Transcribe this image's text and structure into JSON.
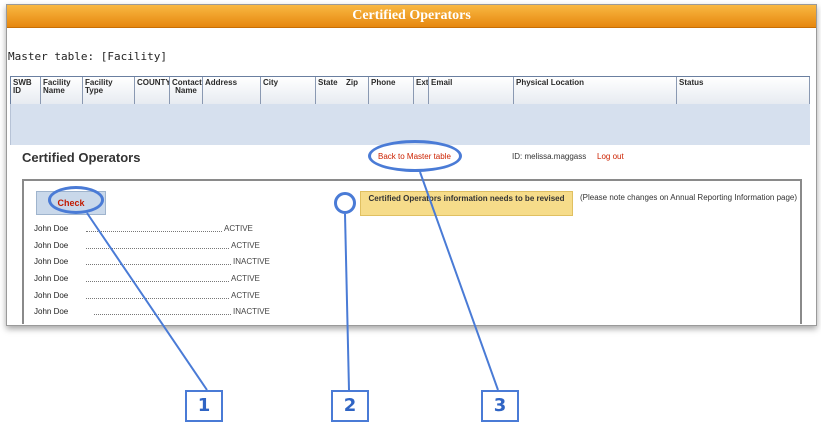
{
  "window": {
    "title": "Certified Operators"
  },
  "master_table_label": "Master table: [Facility]",
  "grid": {
    "columns": [
      "SWB ID",
      "Facility Name",
      "Facility Type",
      "COUNTY",
      "Contact Name",
      "Address",
      "City",
      "State",
      "Zip",
      "Phone",
      "Ext.",
      "Email",
      "Physical Location",
      "Status"
    ]
  },
  "section": {
    "title": "Certified Operators",
    "back_link": "Back to Master table",
    "user_id": "ID: melissa.maggass",
    "logout": "Log out"
  },
  "panel": {
    "check_button": "Check",
    "info_message": "Certified Operators information needs to be revised",
    "note": "(Please note changes on Annual Reporting Information page)"
  },
  "operators": [
    {
      "name": "John Doe",
      "status": "ACTIVE"
    },
    {
      "name": "John Doe",
      "status": "ACTIVE"
    },
    {
      "name": "John Doe",
      "status": "INACTIVE"
    },
    {
      "name": "John Doe",
      "status": "ACTIVE"
    },
    {
      "name": "John Doe",
      "status": "ACTIVE"
    },
    {
      "name": "John Doe",
      "status": "INACTIVE"
    }
  ],
  "callouts": [
    "1",
    "2",
    "3"
  ],
  "colors": {
    "title_bar": "#e6870f",
    "callout_blue": "#4a7bd6",
    "link_red": "#cc2200",
    "info_yellow": "#f6dc8a",
    "grid_body": "#d6e0ee"
  }
}
